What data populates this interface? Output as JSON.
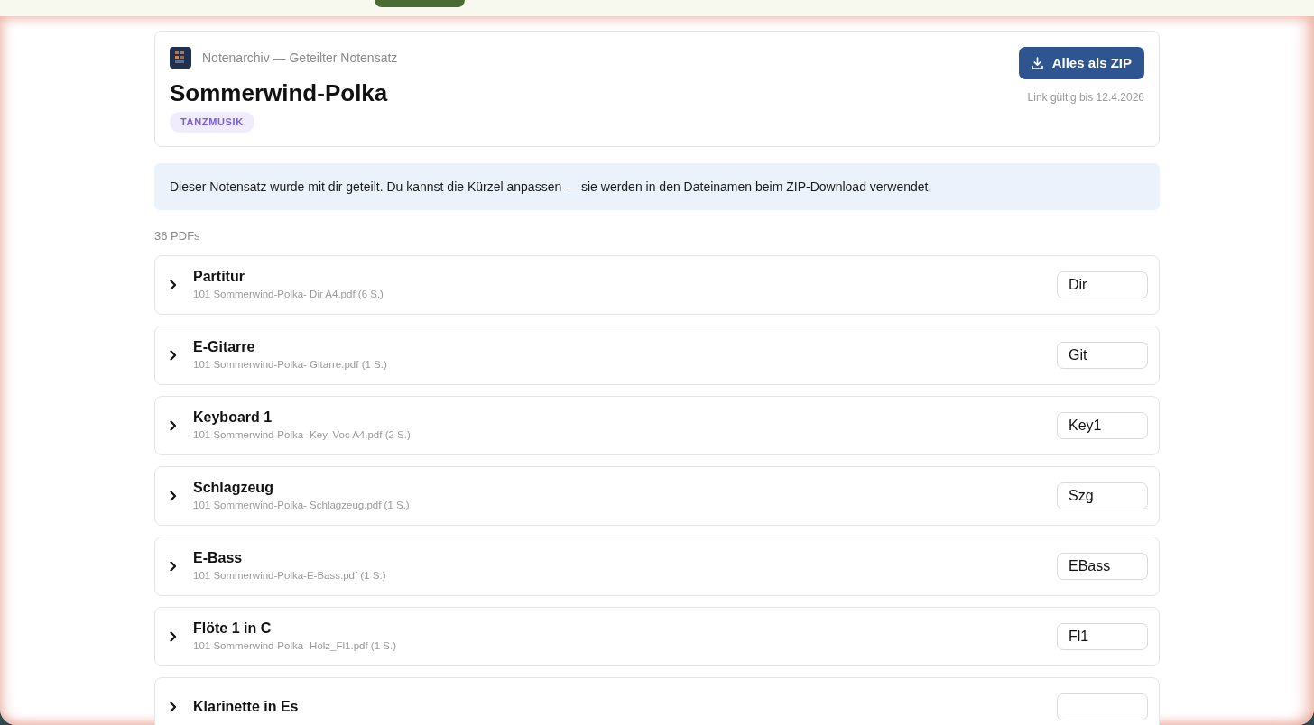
{
  "header": {
    "breadcrumb": "Notenarchiv — Geteilter Notensatz",
    "title": "Sommerwind-Polka",
    "tag": "TANZMUSIK",
    "download_button": "Alles als ZIP",
    "link_validity": "Link gültig bis 12.4.2026"
  },
  "notice": "Dieser Notensatz wurde mit dir geteilt. Du kannst die Kürzel anpassen — sie werden in den Dateinamen beim ZIP-Download verwendet.",
  "count": "36 PDFs",
  "parts": [
    {
      "name": "Partitur",
      "file": "101 Sommerwind-Polka- Dir A4.pdf (6 S.)",
      "shortcut": "Dir",
      "expanded": false
    },
    {
      "name": "E-Gitarre",
      "file": "101 Sommerwind-Polka- Gitarre.pdf (1 S.)",
      "shortcut": "Git",
      "expanded": false
    },
    {
      "name": "Keyboard 1",
      "file": "101 Sommerwind-Polka- Key, Voc A4.pdf (2 S.)",
      "shortcut": "Key1",
      "expanded": false
    },
    {
      "name": "Schlagzeug",
      "file": "101 Sommerwind-Polka- Schlagzeug.pdf (1 S.)",
      "shortcut": "Szg",
      "expanded": false
    },
    {
      "name": "E-Bass",
      "file": "101 Sommerwind-Polka-E-Bass.pdf (1 S.)",
      "shortcut": "EBass",
      "expanded": false
    },
    {
      "name": "Flöte 1 in C",
      "file": "101 Sommerwind-Polka- Holz_Fl1.pdf (1 S.)",
      "shortcut": "Fl1",
      "expanded": false
    },
    {
      "name": "Klarinette in Es",
      "expanded": false
    }
  ]
}
